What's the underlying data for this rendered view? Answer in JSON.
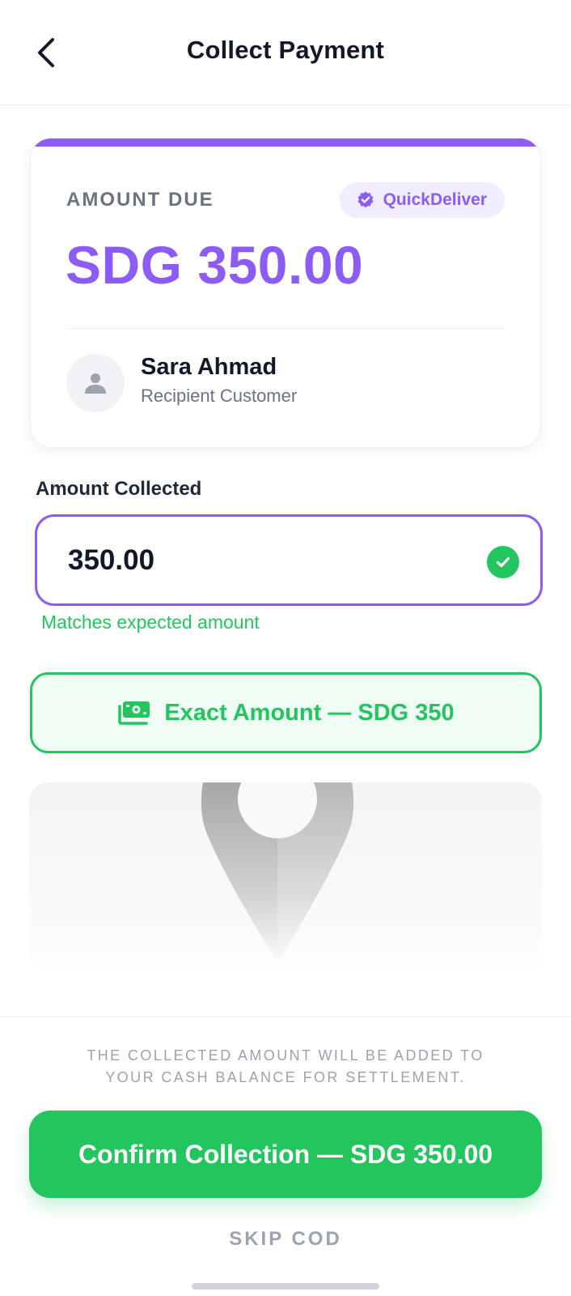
{
  "header": {
    "title": "Collect Payment",
    "back_icon": "chevron-left-icon"
  },
  "due_card": {
    "label": "AMOUNT DUE",
    "brand": {
      "name": "QuickDeliver",
      "icon": "verified-badge-icon"
    },
    "amount": "SDG 350.00",
    "customer": {
      "name": "Sara Ahmad",
      "role": "Recipient Customer",
      "icon": "person-icon"
    }
  },
  "amount_field": {
    "label": "Amount Collected",
    "value": "350.00",
    "status_icon": "check-circle-icon",
    "validation": "Matches expected amount"
  },
  "exact_button": {
    "label": "Exact Amount — SDG 350",
    "icon": "cash-icon"
  },
  "map": {
    "icon": "map-pin-icon"
  },
  "footer": {
    "note_line1": "THE COLLECTED AMOUNT WILL BE ADDED TO",
    "note_line2": "YOUR CASH BALANCE FOR SETTLEMENT.",
    "confirm_label": "Confirm Collection — SDG 350.00",
    "skip_label": "SKIP COD"
  },
  "colors": {
    "accent_purple": "#8b5cf6",
    "success_green": "#22c55e",
    "text_dark": "#111827",
    "text_muted": "#6b7280"
  }
}
